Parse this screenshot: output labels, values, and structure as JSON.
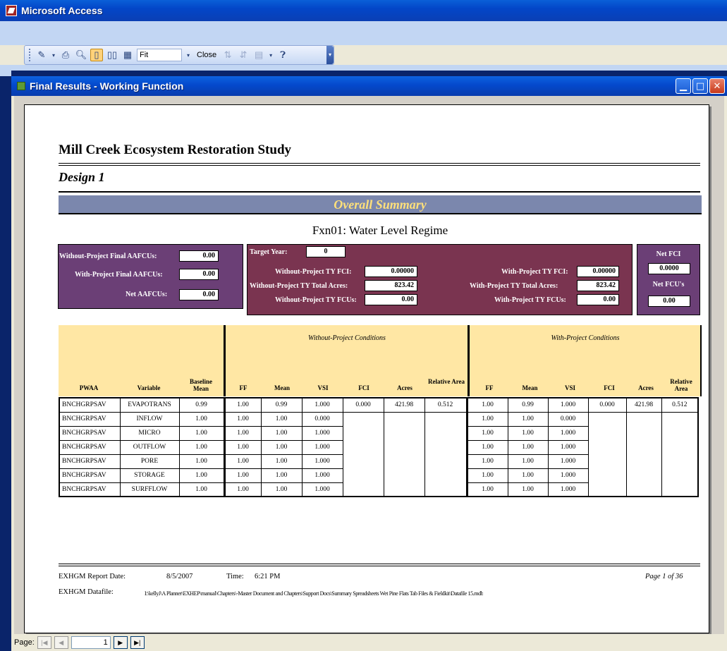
{
  "app": {
    "title": "Microsoft Access"
  },
  "toolbar": {
    "zoom_value": "Fit",
    "close_label": "Close",
    "icons": [
      "view-icon",
      "print-icon",
      "zoom-icon",
      "one-page-icon",
      "two-pages-icon",
      "multiple-pages-icon",
      "sort-ascending-icon",
      "sort-descending-icon",
      "office-links-icon",
      "help-icon"
    ]
  },
  "window": {
    "title": "Final Results - Working Function"
  },
  "report": {
    "title": "Mill Creek Ecosystem Restoration Study",
    "design": "Design 1",
    "summary_banner": "Overall Summary",
    "function_title": "Fxn01: Water Level Regime",
    "left_box": {
      "without_final_label": "Without-Project Final AAFCUs:",
      "without_final_value": "0.00",
      "with_final_label": "With-Project Final AAFCUs:",
      "with_final_value": "0.00",
      "net_label": "Net AAFCUs:",
      "net_value": "0.00"
    },
    "mid_box": {
      "target_year_label": "Target Year:",
      "target_year_value": "0",
      "without_fci_label": "Without-Project TY FCI:",
      "without_fci_value": "0.00000",
      "without_acres_label": "Without-Project TY Total Acres:",
      "without_acres_value": "823.42",
      "without_fcus_label": "Without-Project TY FCUs:",
      "without_fcus_value": "0.00",
      "with_fci_label": "With-Project TY FCI:",
      "with_fci_value": "0.00000",
      "with_acres_label": "With-Project TY Total Acres:",
      "with_acres_value": "823.42",
      "with_fcus_label": "With-Project TY FCUs:",
      "with_fcus_value": "0.00"
    },
    "right_box": {
      "net_fci_label": "Net FCI",
      "net_fci_value": "0.0000",
      "net_fcus_label": "Net FCU's",
      "net_fcus_value": "0.00"
    },
    "table": {
      "without_title": "Without-Project Conditions",
      "with_title": "With-Project Conditions",
      "headers": {
        "pwaa": "PWAA",
        "variable": "Variable",
        "baseline": "Baseline Mean",
        "ff": "FF",
        "mean": "Mean",
        "vsi": "VSI",
        "fci": "FCI",
        "acres": "Acres",
        "relarea": "Relative Area"
      },
      "rows": [
        {
          "pwaa": "BNCHGRPSAV",
          "variable": "EVAPOTRANS",
          "baseline": "0.99",
          "wo_ff": "1.00",
          "wo_mean": "0.99",
          "wo_vsi": "1.000",
          "wo_fci": "0.000",
          "wo_acres": "421.98",
          "wo_rel": "0.512",
          "w_ff": "1.00",
          "w_mean": "0.99",
          "w_vsi": "1.000",
          "w_fci": "0.000",
          "w_acres": "421.98",
          "w_rel": "0.512"
        },
        {
          "pwaa": "BNCHGRPSAV",
          "variable": "INFLOW",
          "baseline": "1.00",
          "wo_ff": "1.00",
          "wo_mean": "1.00",
          "wo_vsi": "0.000",
          "w_ff": "1.00",
          "w_mean": "1.00",
          "w_vsi": "0.000"
        },
        {
          "pwaa": "BNCHGRPSAV",
          "variable": "MICRO",
          "baseline": "1.00",
          "wo_ff": "1.00",
          "wo_mean": "1.00",
          "wo_vsi": "1.000",
          "w_ff": "1.00",
          "w_mean": "1.00",
          "w_vsi": "1.000"
        },
        {
          "pwaa": "BNCHGRPSAV",
          "variable": "OUTFLOW",
          "baseline": "1.00",
          "wo_ff": "1.00",
          "wo_mean": "1.00",
          "wo_vsi": "1.000",
          "w_ff": "1.00",
          "w_mean": "1.00",
          "w_vsi": "1.000"
        },
        {
          "pwaa": "BNCHGRPSAV",
          "variable": "PORE",
          "baseline": "1.00",
          "wo_ff": "1.00",
          "wo_mean": "1.00",
          "wo_vsi": "1.000",
          "w_ff": "1.00",
          "w_mean": "1.00",
          "w_vsi": "1.000"
        },
        {
          "pwaa": "BNCHGRPSAV",
          "variable": "STORAGE",
          "baseline": "1.00",
          "wo_ff": "1.00",
          "wo_mean": "1.00",
          "wo_vsi": "1.000",
          "w_ff": "1.00",
          "w_mean": "1.00",
          "w_vsi": "1.000"
        },
        {
          "pwaa": "BNCHGRPSAV",
          "variable": "SURFFLOW",
          "baseline": "1.00",
          "wo_ff": "1.00",
          "wo_mean": "1.00",
          "wo_vsi": "1.000",
          "w_ff": "1.00",
          "w_mean": "1.00",
          "w_vsi": "1.000"
        }
      ]
    },
    "footer": {
      "report_date_label": "EXHGM Report Date:",
      "report_date": "8/5/2007",
      "time_label": "Time:",
      "time": "6:21 PM",
      "page_text": "Page 1 of 36",
      "datafile_label": "EXHGM Datafile:",
      "datafile": "I:\\kellyJ\\A Planner\\EXHEP\\manual\\Chapters\\-Master Document and Chapters\\Support Docs\\Summary Spreadsheets Wet Pine Flats Tab Files & Fieldkit\\Datafile 15.mdb"
    }
  },
  "navigation": {
    "label": "Page:",
    "current_page": "1"
  },
  "colors": {
    "xp_title_blue": "#0a5fd8",
    "summary_banner": "#7b87ad",
    "banner_text": "#ffe07a",
    "purple_box": "#6b3f76",
    "maroon_box": "#7a3450",
    "header_band": "#ffe7a4"
  }
}
